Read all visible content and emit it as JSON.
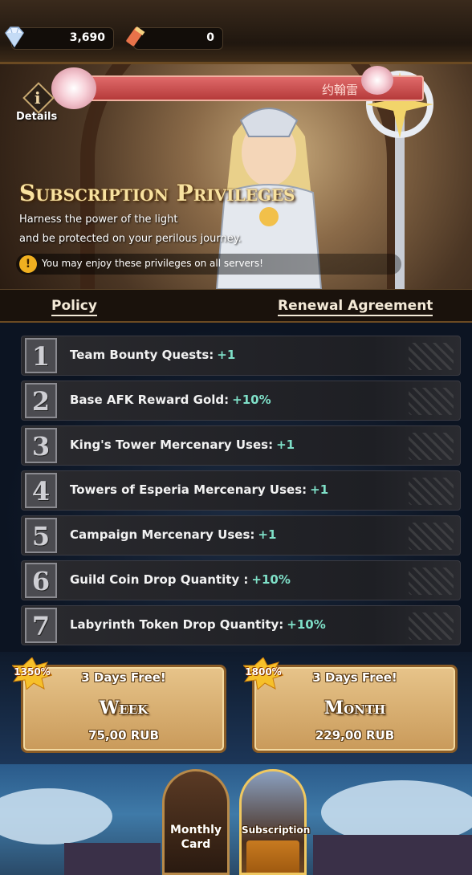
{
  "currency": {
    "gems": {
      "icon": "diamond-icon",
      "value": "3,690"
    },
    "scrolls": {
      "icon": "scroll-icon",
      "value": "0"
    }
  },
  "banner": {
    "hero_name": "约翰雷",
    "details_label": "Details",
    "title": "Subscription Privileges",
    "tagline_1": "Harness the power of the light",
    "tagline_2": "and be protected on your perilous journey.",
    "notice": "You may enjoy these privileges on all servers!"
  },
  "tabs": {
    "policy": "Policy",
    "renewal": "Renewal Agreement"
  },
  "privileges": [
    {
      "num": "1",
      "label": "Team Bounty Quests:",
      "bonus": "+1"
    },
    {
      "num": "2",
      "label": "Base AFK Reward Gold:",
      "bonus": "+10%"
    },
    {
      "num": "3",
      "label": "King's Tower Mercenary Uses:",
      "bonus": "+1"
    },
    {
      "num": "4",
      "label": "Towers of Esperia Mercenary Uses:",
      "bonus": "+1"
    },
    {
      "num": "5",
      "label": "Campaign Mercenary Uses:",
      "bonus": "+1"
    },
    {
      "num": "6",
      "label": "Guild Coin Drop Quantity :",
      "bonus": "+10%"
    },
    {
      "num": "7",
      "label": "Labyrinth Token Drop Quantity:",
      "bonus": "+10%"
    }
  ],
  "plans": {
    "week": {
      "badge": "1350%",
      "free": "3 Days Free!",
      "period": "Week",
      "price": "75,00 RUB"
    },
    "month": {
      "badge": "1800%",
      "free": "3 Days Free!",
      "period": "Month",
      "price": "229,00 RUB"
    }
  },
  "nav": {
    "monthly_line1": "Monthly",
    "monthly_line2": "Card",
    "subscription": "Subscription"
  },
  "colors": {
    "bonus": "#7fe0c8",
    "gold": "#e7c48a",
    "ribbon": "#d05050"
  }
}
